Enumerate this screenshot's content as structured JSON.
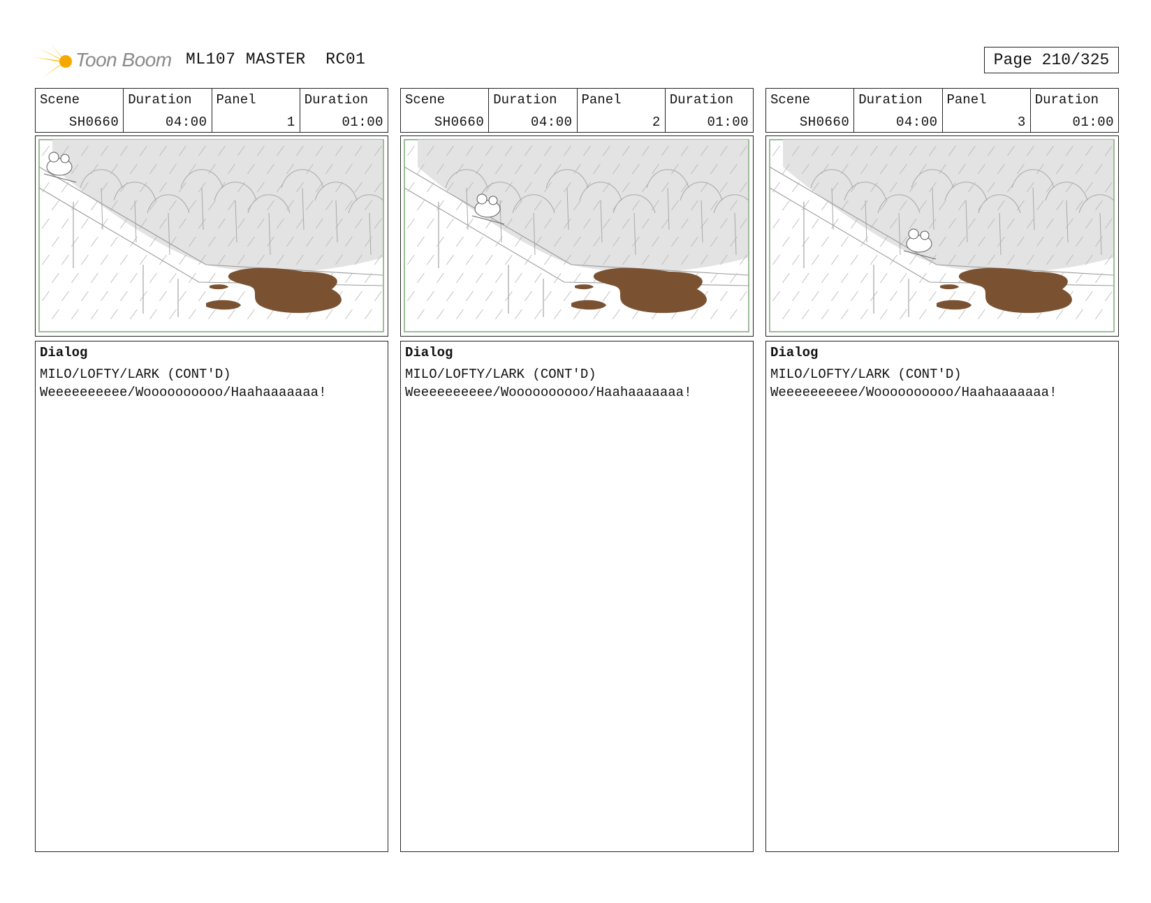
{
  "header": {
    "logo_text": "Toon Boom",
    "title": "ML107 MASTER  RC01",
    "page": "Page 210/325"
  },
  "labels": {
    "scene": "Scene",
    "duration": "Duration",
    "panel": "Panel",
    "dialog": "Dialog"
  },
  "panels": [
    {
      "scene": "SH0660",
      "scene_duration": "04:00",
      "panel": "1",
      "panel_duration": "01:00",
      "dialog_character": "MILO/LOFTY/LARK (CONT'D)",
      "dialog_line": "Weeeeeeeeee/Woooooooooo/Haahaaaaaaa!"
    },
    {
      "scene": "SH0660",
      "scene_duration": "04:00",
      "panel": "2",
      "panel_duration": "01:00",
      "dialog_character": "MILO/LOFTY/LARK (CONT'D)",
      "dialog_line": "Weeeeeeeeee/Woooooooooo/Haahaaaaaaa!"
    },
    {
      "scene": "SH0660",
      "scene_duration": "04:00",
      "panel": "3",
      "panel_duration": "01:00",
      "dialog_character": "MILO/LOFTY/LARK (CONT'D)",
      "dialog_line": "Weeeeeeeeee/Woooooooooo/Haahaaaaaaa!"
    }
  ],
  "colors": {
    "frame_border": "#7aa874",
    "sky": "#e3e3e3",
    "mud": "#7a5232",
    "logo_star": "#f5c000"
  }
}
